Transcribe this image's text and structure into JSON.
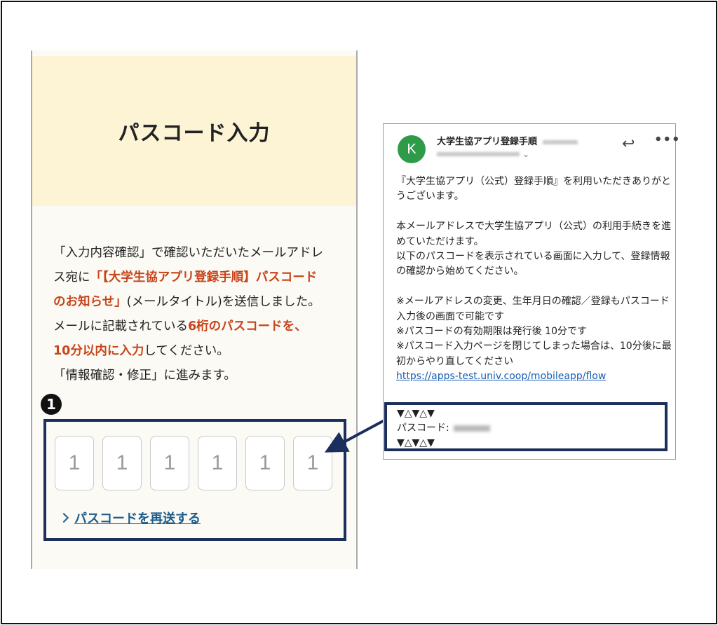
{
  "phone": {
    "title": "パスコード入力",
    "instructions": {
      "line1": "「入力内容確認」で確認いただいたメールアドレ",
      "line2_a": "ス宛に",
      "line2_red": "「【大学生協アプリ登録手順】パスコード",
      "line3_red": "のお知らせ」",
      "line3_b": "(メールタイトル)を送信しました。",
      "line4_a": "メールに記載されている",
      "line4_red": "6桁のパスコードを、",
      "line5_red": "10分以内に入力",
      "line5_b": "してください。",
      "line6": "「情報確認・修正」に進みます。"
    },
    "step_number": "1",
    "code_digits": [
      "1",
      "1",
      "1",
      "1",
      "1",
      "1"
    ],
    "resend_label": "パスコードを再送する"
  },
  "email": {
    "avatar_letter": "K",
    "sender": "大学生協アプリ登録手順",
    "paragraph1": "『大学生協アプリ（公式）登録手順』を利用いただきありがとうございます。",
    "paragraph2_line1": "本メールアドレスで大学生協アプリ（公式）の利用手続きを進めていただけます。",
    "paragraph2_line2": "以下のパスコードを表示されている画面に入力して、登録情報の確認から始めてください。",
    "note1": "※メールアドレスの変更、生年月日の確認／登録もパスコード入力後の画面で可能です",
    "note2": "※パスコードの有効期限は発行後 10分です",
    "note3": "※パスコード入力ページを閉じてしまった場合は、10分後に最初からやり直してください",
    "link": "https://apps-test.univ.coop/mobileapp/flow",
    "code_marker": "▼△▼△▼",
    "code_label": "パスコード:"
  },
  "icons": {
    "reply": "reply-icon",
    "more": "more-icon",
    "chevron": "chevron-right-icon"
  },
  "colors": {
    "accent_red": "#c8441a",
    "highlight_navy": "#1c2e5b",
    "header_bg": "#fdf4d6",
    "avatar_green": "#2e9b49",
    "link_blue": "#1d5c8a"
  }
}
